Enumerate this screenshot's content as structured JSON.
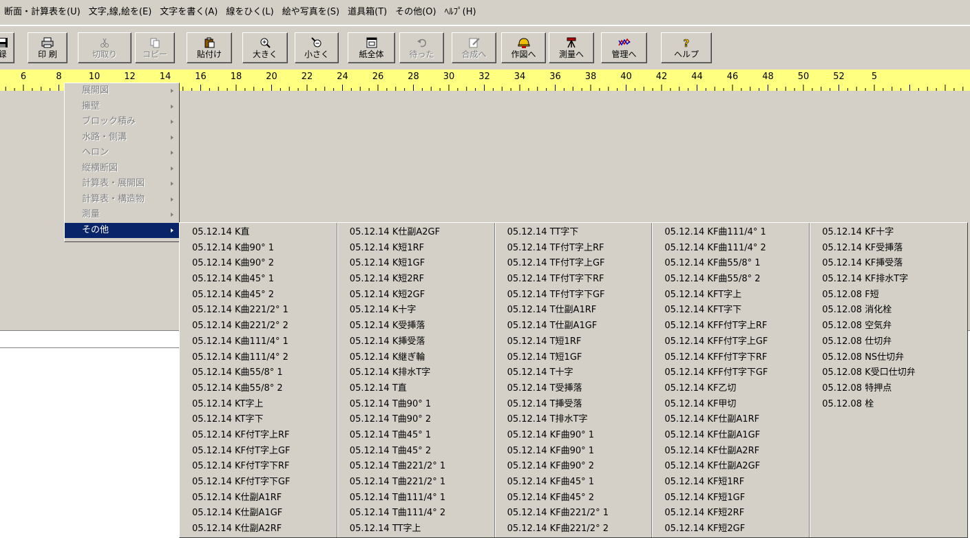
{
  "menubar": {
    "items": [
      "断面・計算表を(U)",
      "文字,線,絵を(E)",
      "文字を書く(A)",
      "線をひく(L)",
      "絵や写真を(S)",
      "道具箱(T)",
      "その他(O)",
      "ﾍﾙﾌﾟ(H)"
    ]
  },
  "toolbar": {
    "buttons": [
      {
        "label": "録",
        "icon": "save-icon",
        "enabled": true
      },
      {
        "label": "印 刷",
        "icon": "printer-icon",
        "enabled": true
      },
      {
        "label": "切取り",
        "icon": "scissors-icon",
        "enabled": false
      },
      {
        "label": "コピー",
        "icon": "copy-icon",
        "enabled": false
      },
      {
        "label": "貼付け",
        "icon": "paste-icon",
        "enabled": true
      },
      {
        "label": "大きく",
        "icon": "zoom-in-icon",
        "enabled": true
      },
      {
        "label": "小さく",
        "icon": "zoom-out-icon",
        "enabled": true
      },
      {
        "label": "紙全体",
        "icon": "full-page-icon",
        "enabled": true
      },
      {
        "label": "待った",
        "icon": "undo-icon",
        "enabled": false
      },
      {
        "label": "合成へ",
        "icon": "compose-icon",
        "enabled": false
      },
      {
        "label": "作図へ",
        "icon": "helmet-icon",
        "enabled": true
      },
      {
        "label": "測量へ",
        "icon": "survey-tripod-icon",
        "enabled": true
      },
      {
        "label": "管理へ",
        "icon": "management-chart-icon",
        "enabled": true
      },
      {
        "label": "ヘルプ",
        "icon": "help-question-icon",
        "enabled": true
      }
    ]
  },
  "ruler": {
    "numbers": [
      "6",
      "8",
      "10",
      "12",
      "14",
      "16",
      "18",
      "20",
      "22",
      "24",
      "26",
      "28",
      "30",
      "32",
      "34",
      "36",
      "38",
      "40",
      "42",
      "44",
      "46",
      "48",
      "50",
      "52",
      "5"
    ]
  },
  "popup_menu": {
    "items": [
      {
        "label": "展開図",
        "active": false
      },
      {
        "label": "擁壁",
        "active": false
      },
      {
        "label": "ブロック積み",
        "active": false
      },
      {
        "label": "水路・側溝",
        "active": false
      },
      {
        "label": "ヘロン",
        "active": false
      },
      {
        "label": "縦横断図",
        "active": false
      },
      {
        "label": "計算表・展開図",
        "active": false
      },
      {
        "label": "計算表・構造物",
        "active": false
      },
      {
        "label": "測量",
        "active": false
      },
      {
        "label": "その他",
        "active": true
      }
    ]
  },
  "submenu": {
    "columns": [
      [
        "05.12.14  K直",
        "05.12.14  K曲90° 1",
        "05.12.14  K曲90° 2",
        "05.12.14  K曲45° 1",
        "05.12.14  K曲45° 2",
        "05.12.14  K曲221/2° 1",
        "05.12.14  K曲221/2° 2",
        "05.12.14  K曲111/4° 1",
        "05.12.14  K曲111/4° 2",
        "05.12.14  K曲55/8° 1",
        "05.12.14  K曲55/8° 2",
        "05.12.14  KT字上",
        "05.12.14  KT字下",
        "05.12.14  KF付T字上RF",
        "05.12.14  KF付T字上GF",
        "05.12.14  KF付T字下RF",
        "05.12.14  KF付T字下GF",
        "05.12.14  K仕副A1RF",
        "05.12.14  K仕副A1GF",
        "05.12.14  K仕副A2RF"
      ],
      [
        "05.12.14  K仕副A2GF",
        "05.12.14  K短1RF",
        "05.12.14  K短1GF",
        "05.12.14  K短2RF",
        "05.12.14  K短2GF",
        "05.12.14  K十字",
        "05.12.14  K受挿落",
        "05.12.14  K挿受落",
        "05.12.14  K継ぎ輪",
        "05.12.14  K排水T字",
        "05.12.14  T直",
        "05.12.14  T曲90° 1",
        "05.12.14  T曲90° 2",
        "05.12.14  T曲45° 1",
        "05.12.14  T曲45° 2",
        "05.12.14  T曲221/2° 1",
        "05.12.14  T曲221/2° 1",
        "05.12.14  T曲111/4° 1",
        "05.12.14  T曲111/4° 2",
        "05.12.14  TT字上"
      ],
      [
        "05.12.14  TT字下",
        "05.12.14  TF付T字上RF",
        "05.12.14  TF付T字上GF",
        "05.12.14  TF付T字下RF",
        "05.12.14  TF付T字下GF",
        "05.12.14  T仕副A1RF",
        "05.12.14  T仕副A1GF",
        "05.12.14  T短1RF",
        "05.12.14  T短1GF",
        "05.12.14  T十字",
        "05.12.14  T受挿落",
        "05.12.14  T挿受落",
        "05.12.14  T排水T字",
        "05.12.14  KF曲90° 1",
        "05.12.14  KF曲90° 1",
        "05.12.14  KF曲90° 2",
        "05.12.14  KF曲45° 1",
        "05.12.14  KF曲45° 2",
        "05.12.14  KF曲221/2° 1",
        "05.12.14  KF曲221/2° 2"
      ],
      [
        "05.12.14  KF曲111/4° 1",
        "05.12.14  KF曲111/4° 2",
        "05.12.14  KF曲55/8° 1",
        "05.12.14  KF曲55/8° 2",
        "05.12.14  KFT字上",
        "05.12.14  KFT字下",
        "05.12.14  KFF付T字上RF",
        "05.12.14  KFF付T字上GF",
        "05.12.14  KFF付T字下RF",
        "05.12.14  KFF付T字下GF",
        "05.12.14  KF乙切",
        "05.12.14  KF甲切",
        "05.12.14  KF仕副A1RF",
        "05.12.14  KF仕副A1GF",
        "05.12.14  KF仕副A2RF",
        "05.12.14  KF仕副A2GF",
        "05.12.14  KF短1RF",
        "05.12.14  KF短1GF",
        "05.12.14  KF短2RF",
        "05.12.14  KF短2GF"
      ],
      [
        "05.12.14  KF十字",
        "05.12.14  KF受挿落",
        "05.12.14  KF挿受落",
        "05.12.14  KF排水T字",
        "05.12.08  F短",
        "05.12.08  消化栓",
        "05.12.08  空気弁",
        "05.12.08  仕切弁",
        "05.12.08  NS仕切弁",
        "05.12.08  K受口仕切弁",
        "05.12.08  特押点",
        "05.12.08  栓"
      ]
    ]
  },
  "colors": {
    "window_gray": "#d4d0c8",
    "ruler_yellow": "#ffff80",
    "highlight_navy": "#0a246a"
  }
}
